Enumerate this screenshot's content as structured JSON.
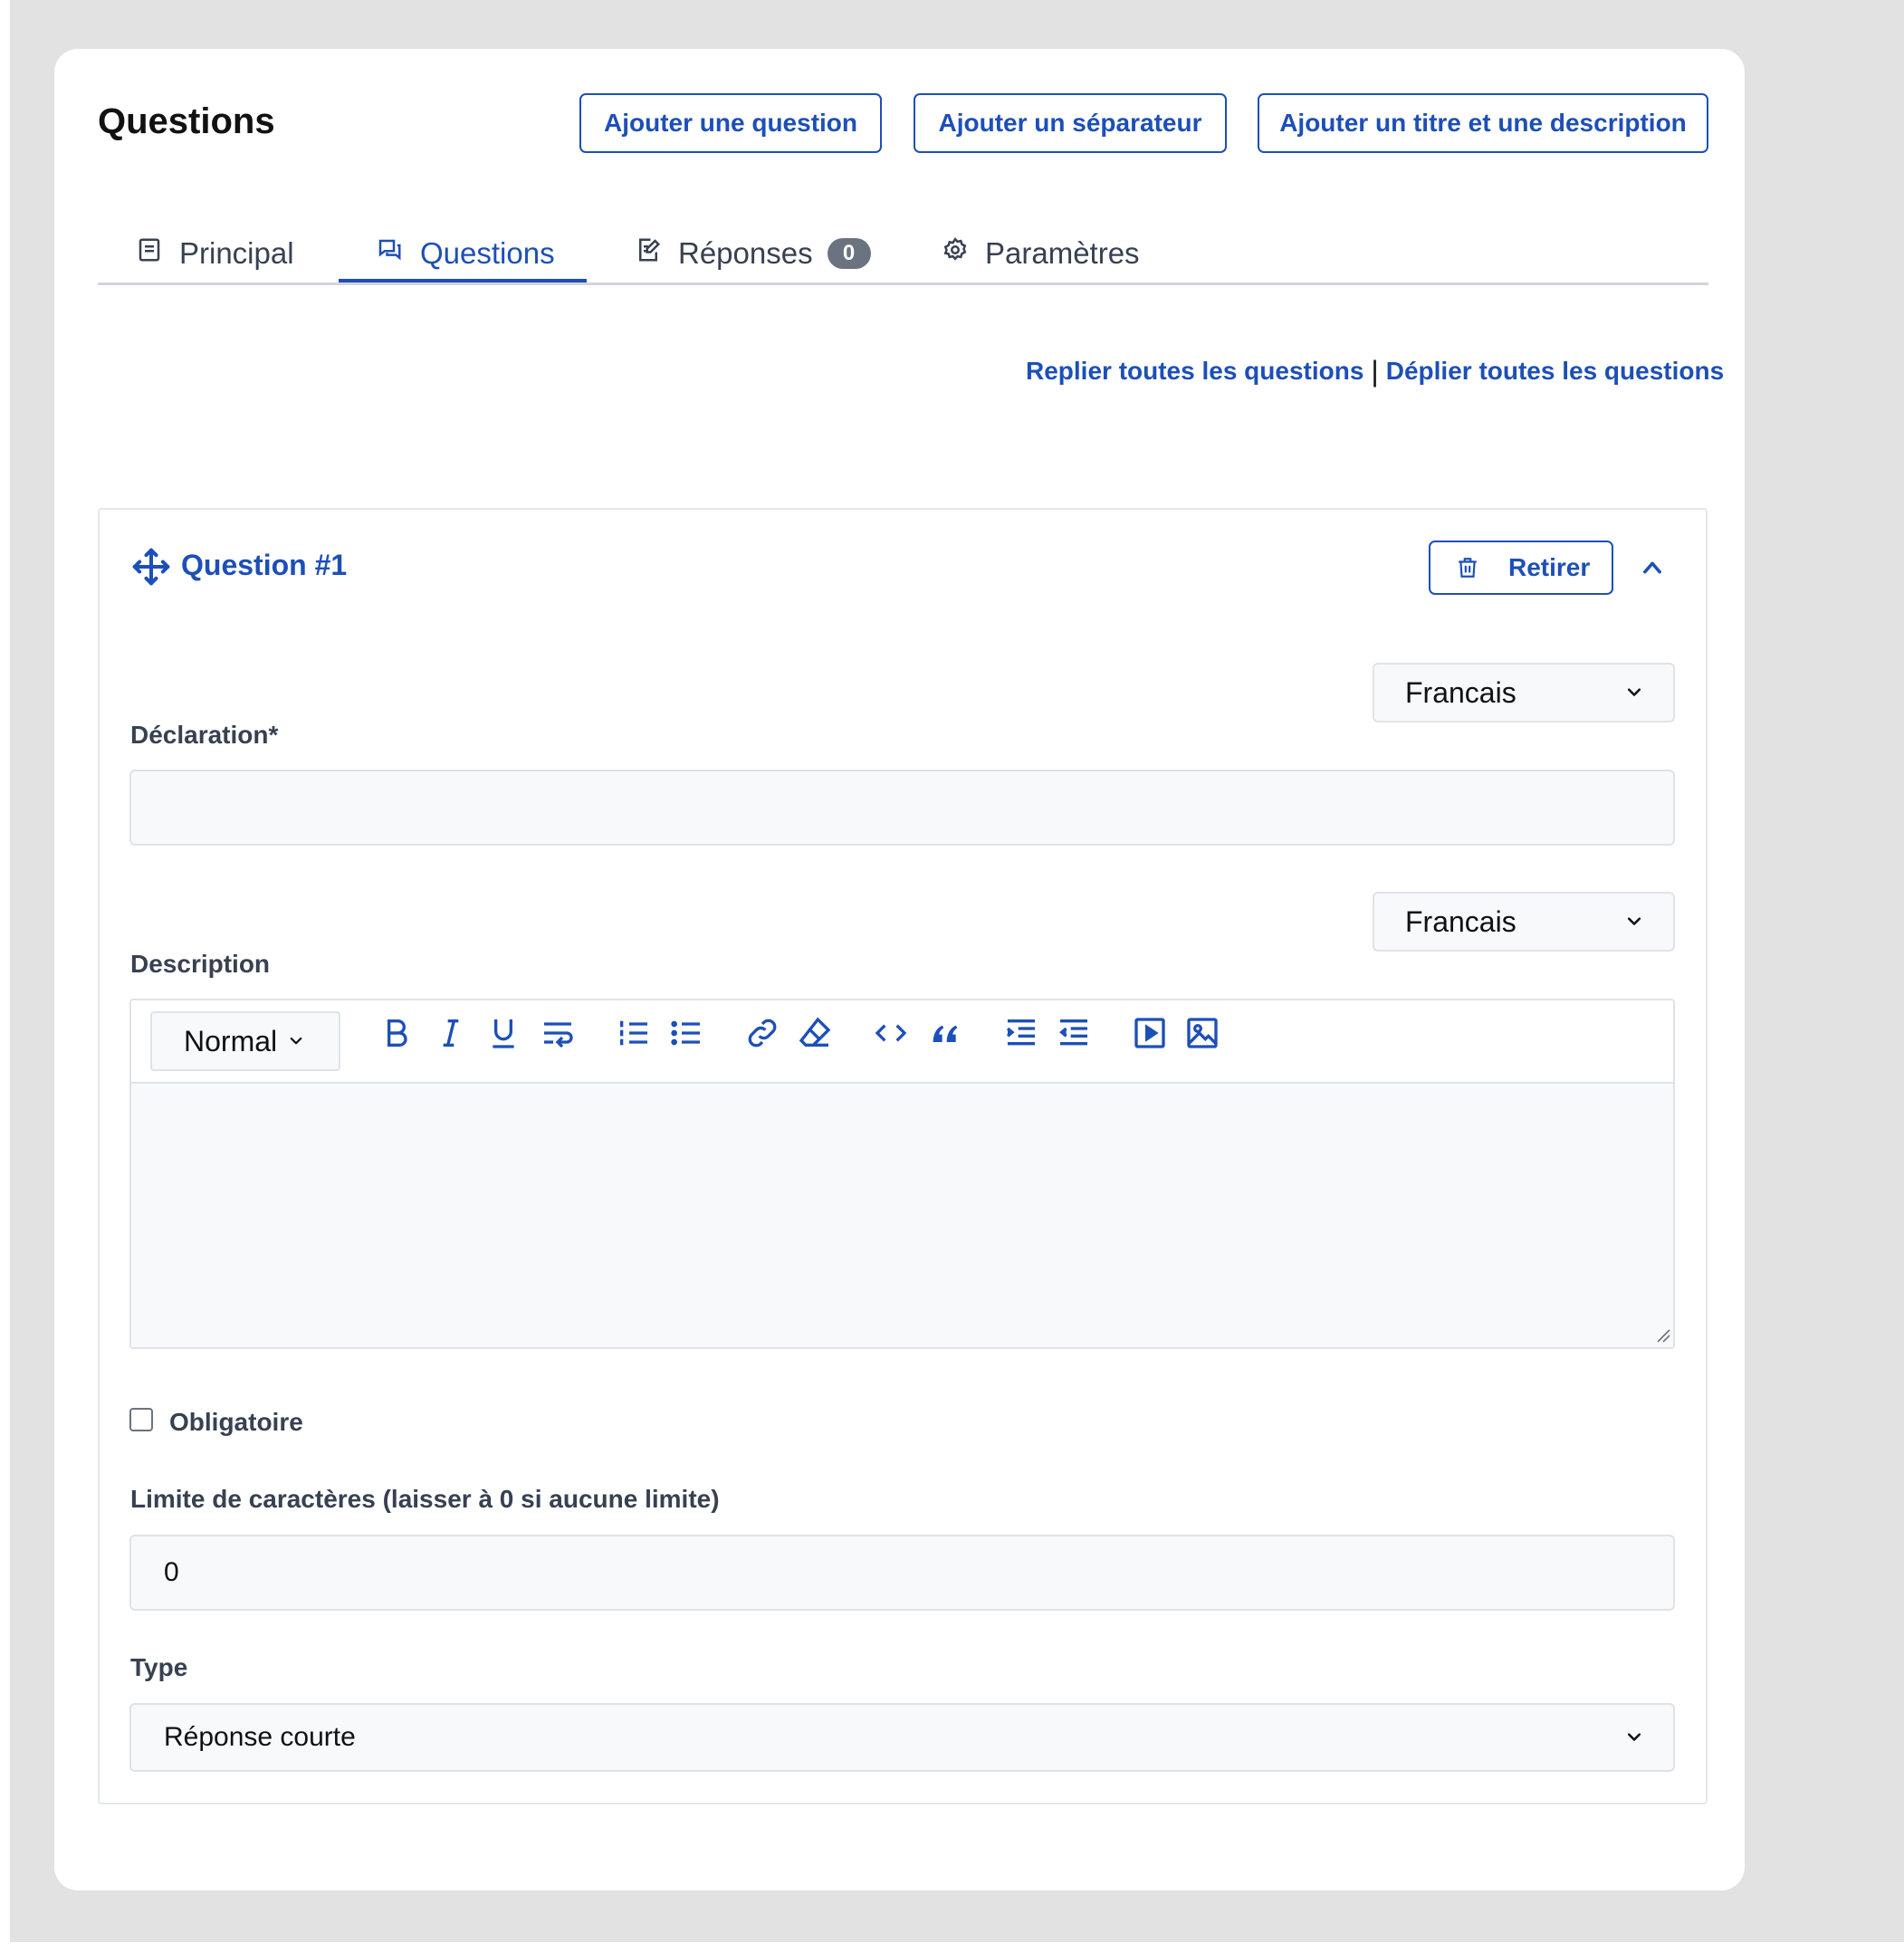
{
  "header": {
    "title": "Questions",
    "buttons": {
      "add_question": "Ajouter une question",
      "add_separator": "Ajouter un séparateur",
      "add_title_description": "Ajouter un titre et une description"
    }
  },
  "tabs": [
    {
      "label": "Principal",
      "icon": "document-icon"
    },
    {
      "label": "Questions",
      "icon": "chat-icon",
      "active": true
    },
    {
      "label": "Réponses",
      "icon": "edit-note-icon",
      "badge": "0"
    },
    {
      "label": "Paramètres",
      "icon": "gear-icon"
    }
  ],
  "actions": {
    "collapse_all": "Replier toutes les questions",
    "separator": "|",
    "expand_all": "Déplier toutes les questions"
  },
  "question": {
    "title": "Question #1",
    "remove_label": "Retirer",
    "declaration": {
      "language": "Francais",
      "label": "Déclaration*",
      "value": ""
    },
    "description": {
      "language": "Francais",
      "label": "Description",
      "toolbar": {
        "format": "Normal",
        "icons": [
          "bold-icon",
          "italic-icon",
          "underline-icon",
          "text-wrap-icon",
          "ordered-list-icon",
          "bullet-list-icon",
          "link-icon",
          "eraser-icon",
          "code-icon",
          "quote-icon",
          "indent-icon",
          "outdent-icon",
          "video-icon",
          "image-icon"
        ]
      },
      "value": ""
    },
    "required": {
      "label": "Obligatoire",
      "checked": false
    },
    "char_limit": {
      "label": "Limite de caractères (laisser à 0 si aucune limite)",
      "value": "0"
    },
    "type": {
      "label": "Type",
      "value": "Réponse courte"
    }
  },
  "colors": {
    "accent": "#1d4fb8",
    "badge": "#6b7280",
    "background": "#e2e2e2"
  }
}
